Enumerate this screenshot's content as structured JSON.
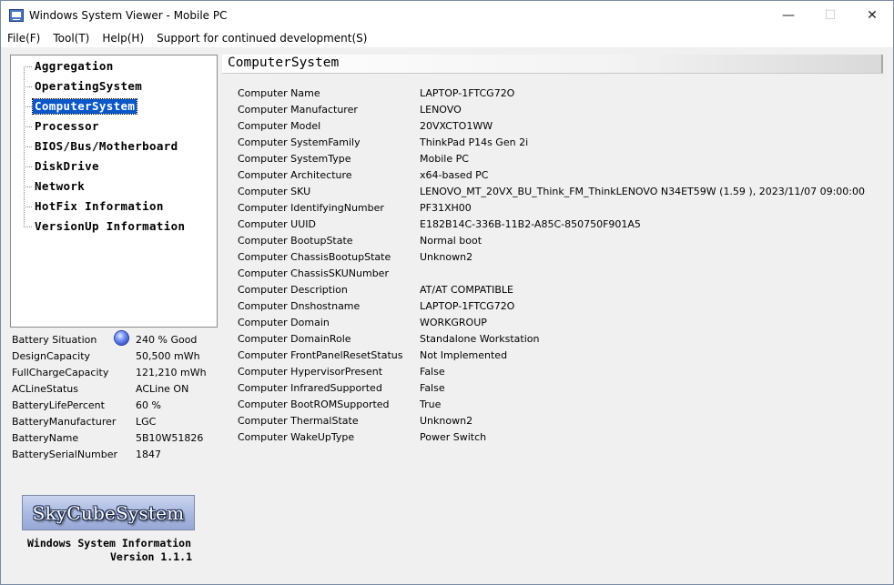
{
  "window": {
    "title": "Windows System Viewer - Mobile PC"
  },
  "caption_buttons": {
    "minimize": "—",
    "maximize": "☐",
    "close": "✕"
  },
  "menu": [
    "File(F)",
    "Tool(T)",
    "Help(H)",
    "Support for continued development(S)"
  ],
  "tree": {
    "items": [
      "Aggregation",
      "OperatingSystem",
      "ComputerSystem",
      "Processor",
      "BIOS/Bus/Motherboard",
      "DiskDrive",
      "Network",
      "HotFix Information",
      "VersionUp Information"
    ],
    "selected": "ComputerSystem"
  },
  "battery": [
    {
      "key": "Battery Situation",
      "value": "240 % Good"
    },
    {
      "key": "DesignCapacity",
      "value": "50,500 mWh"
    },
    {
      "key": "FullChargeCapacity",
      "value": "121,210 mWh"
    },
    {
      "key": "ACLineStatus",
      "value": "ACLine ON"
    },
    {
      "key": "BatteryLifePercent",
      "value": "60 %"
    },
    {
      "key": "BatteryManufacturer",
      "value": "LGC"
    },
    {
      "key": "BatteryName",
      "value": "5B10W51826"
    },
    {
      "key": "BatterySerialNumber",
      "value": "1847"
    }
  ],
  "logo": {
    "text": "SkyCubeSystem",
    "caption_line1": "Windows System Information",
    "caption_line2": "Version 1.1.1"
  },
  "section": {
    "title": "ComputerSystem"
  },
  "properties": [
    {
      "key": "Computer Name",
      "value": "LAPTOP-1FTCG72O"
    },
    {
      "key": "Computer Manufacturer",
      "value": "LENOVO"
    },
    {
      "key": "Computer Model",
      "value": "20VXCTO1WW"
    },
    {
      "key": "Computer SystemFamily",
      "value": "ThinkPad P14s Gen 2i"
    },
    {
      "key": "Computer SystemType",
      "value": "Mobile PC"
    },
    {
      "key": "Computer Architecture",
      "value": "x64-based PC"
    },
    {
      "key": "Computer SKU",
      "value": "LENOVO_MT_20VX_BU_Think_FM_ThinkLENOVO N34ET59W (1.59 ), 2023/11/07 09:00:00"
    },
    {
      "key": "Computer IdentifyingNumber",
      "value": "PF31XH00"
    },
    {
      "key": "Computer UUID",
      "value": "E182B14C-336B-11B2-A85C-850750F901A5"
    },
    {
      "key": "Computer BootupState",
      "value": "Normal boot"
    },
    {
      "key": "Computer ChassisBootupState",
      "value": "Unknown2"
    },
    {
      "key": "Computer ChassisSKUNumber",
      "value": ""
    },
    {
      "key": "Computer Description",
      "value": "AT/AT COMPATIBLE"
    },
    {
      "key": "Computer Dnshostname",
      "value": "LAPTOP-1FTCG72O"
    },
    {
      "key": "Computer Domain",
      "value": "WORKGROUP"
    },
    {
      "key": "Computer DomainRole",
      "value": "Standalone Workstation"
    },
    {
      "key": "Computer FrontPanelResetStatus",
      "value": "Not Implemented"
    },
    {
      "key": "Computer HypervisorPresent",
      "value": "False"
    },
    {
      "key": "Computer InfraredSupported",
      "value": "False"
    },
    {
      "key": "Computer BootROMSupported",
      "value": "True"
    },
    {
      "key": "Computer ThermalState",
      "value": "Unknown2"
    },
    {
      "key": "Computer WakeUpType",
      "value": "Power Switch"
    }
  ]
}
